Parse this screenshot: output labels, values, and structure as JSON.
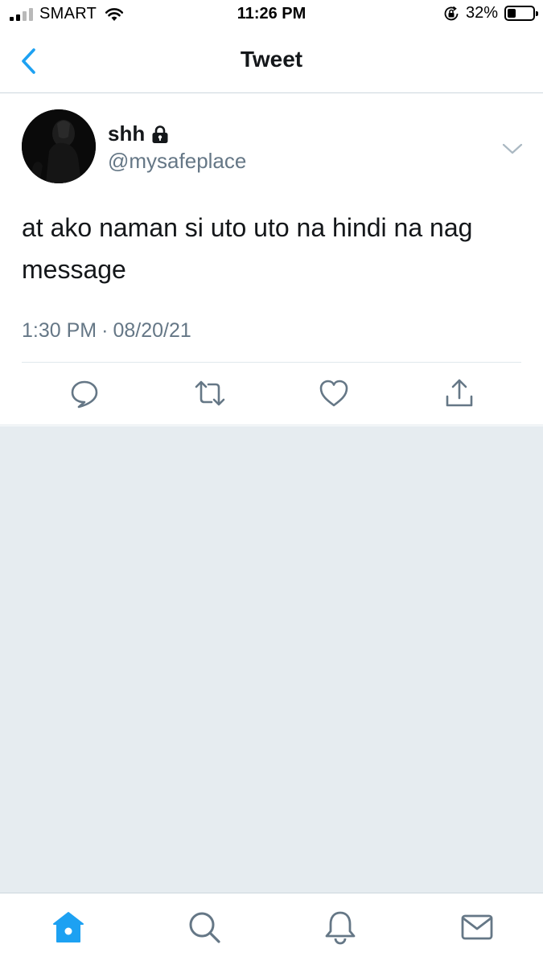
{
  "status_bar": {
    "carrier": "SMART",
    "time": "11:26 PM",
    "battery_percent": "32%",
    "battery_level": 0.32,
    "signal_bars": 2,
    "icons": [
      "signal-icon",
      "wifi-icon",
      "orientation-lock-icon",
      "battery-icon"
    ]
  },
  "nav": {
    "title": "Tweet",
    "back_icon": "chevron-left-icon"
  },
  "tweet": {
    "display_name": "shh",
    "protected_icon": "lock-icon",
    "handle": "@mysafeplace",
    "text": "at ako naman si uto uto na hindi na nag message",
    "time": "1:30 PM",
    "separator": "·",
    "date": "08/20/21",
    "actions": [
      "reply-icon",
      "retweet-icon",
      "like-icon",
      "share-icon"
    ]
  },
  "tab_bar": {
    "tabs": [
      "home-icon",
      "search-icon",
      "notifications-icon",
      "messages-icon"
    ],
    "active": "home-icon"
  },
  "colors": {
    "accent": "#1da1f2",
    "icon_grey": "#657786",
    "background_grey": "#e6ecf0"
  }
}
